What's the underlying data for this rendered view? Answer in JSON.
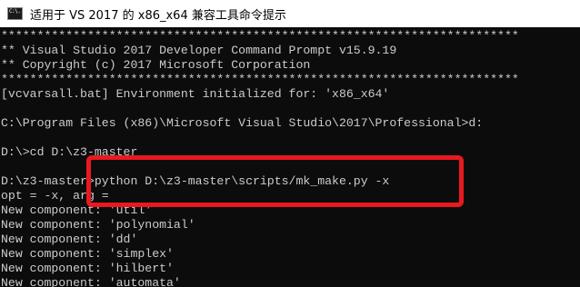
{
  "window": {
    "title": "适用于 VS 2017 的 x86_x64 兼容工具命令提示",
    "icon": "cmd-icon",
    "icon_text": "C:\\."
  },
  "console": {
    "lines": [
      "************************************************************************",
      "** Visual Studio 2017 Developer Command Prompt v15.9.19",
      "** Copyright (c) 2017 Microsoft Corporation",
      "************************************************************************",
      "[vcvarsall.bat] Environment initialized for: 'x86_x64'",
      "",
      "C:\\Program Files (x86)\\Microsoft Visual Studio\\2017\\Professional>d:",
      "",
      "D:\\>cd D:\\z3-master",
      "",
      "D:\\z3-master>python D:\\z3-master\\scripts/mk_make.py -x",
      "opt = -x, arg =",
      "New component: 'util'",
      "New component: 'polynomial'",
      "New component: 'dd'",
      "New component: 'simplex'",
      "New component: 'hilbert'",
      "New component: 'automata'"
    ]
  },
  "highlight": {
    "color": "#e8191f"
  }
}
